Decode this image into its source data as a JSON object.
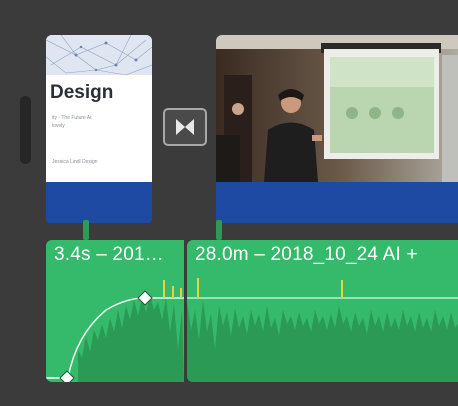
{
  "title_clip": {
    "slide_title": "Design",
    "slide_subtitle": "ity - The Future At",
    "slide_subtitle2": "lovely",
    "slide_footer": "Jessica Lindl Design"
  },
  "audio_clips": [
    {
      "label": "3.4s – 201…"
    },
    {
      "label": "28.0m – 2018_10_24 AI +"
    }
  ],
  "icons": {
    "transition": "bowtie-transition-icon",
    "keyframe": "diamond-keyframe-icon"
  },
  "colors": {
    "background": "#3b3b3b",
    "video_bar": "#1f4aa3",
    "audio_green": "#35b96a",
    "waveform_dark": "#2a9a55",
    "peak_yellow": "#e6d23a"
  }
}
